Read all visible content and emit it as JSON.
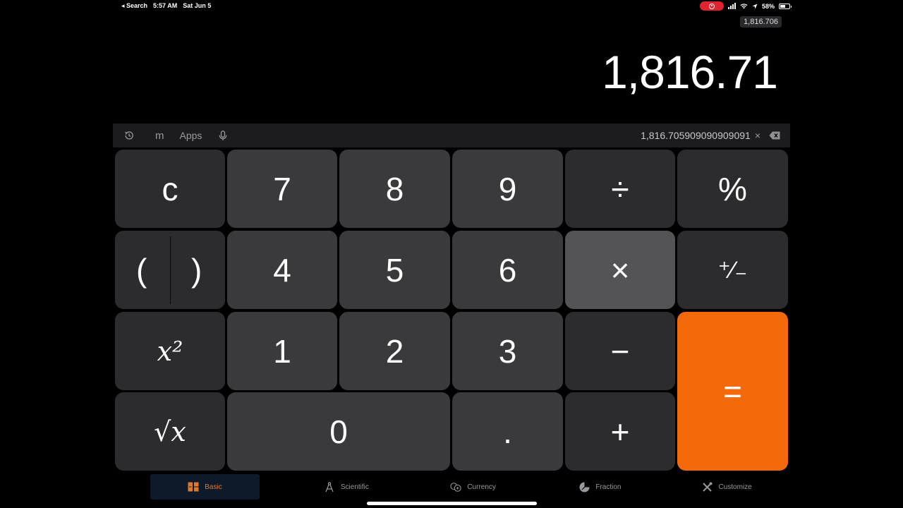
{
  "status_bar": {
    "back_label": "◂ Search",
    "time": "5:57 AM",
    "date": "Sat Jun 5",
    "battery": "58%",
    "battery_level": 0.58
  },
  "memory_chip": "1,816.706",
  "display": {
    "value": "1,816.71"
  },
  "expression_bar": {
    "memory_label": "m",
    "apps_label": "Apps",
    "expression": "1,816.705909090909091",
    "close_symbol": "×"
  },
  "keys": {
    "clear": "c",
    "seven": "7",
    "eight": "8",
    "nine": "9",
    "divide": "÷",
    "percent": "%",
    "open_paren": "(",
    "close_paren": ")",
    "four": "4",
    "five": "5",
    "six": "6",
    "multiply": "×",
    "plus_minus": "⁺∕₋",
    "square": "x²",
    "one": "1",
    "two": "2",
    "three": "3",
    "minus": "−",
    "equals": "=",
    "sqrt": "√x",
    "zero": "0",
    "decimal": ".",
    "plus": "+"
  },
  "tabs": [
    {
      "label": "Basic",
      "icon": "basic-grid-icon",
      "active": true
    },
    {
      "label": "Scientific",
      "icon": "compass-icon",
      "active": false
    },
    {
      "label": "Currency",
      "icon": "currency-exchange-icon",
      "active": false
    },
    {
      "label": "Fraction",
      "icon": "fraction-icon",
      "active": false
    },
    {
      "label": "Customize",
      "icon": "tools-icon",
      "active": false
    }
  ],
  "colors": {
    "accent": "#f46a0a",
    "key_number": "#3a3a3c",
    "key_function": "#2c2c2e",
    "key_active": "#545456",
    "background": "#000000"
  }
}
